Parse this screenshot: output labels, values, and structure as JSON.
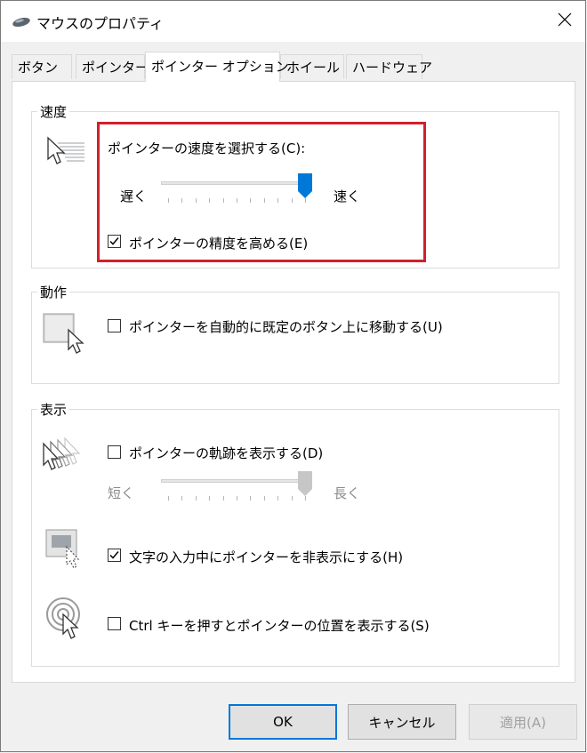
{
  "window": {
    "title": "マウスのプロパティ"
  },
  "tabs": [
    {
      "label": "ボタン",
      "active": false
    },
    {
      "label": "ポインター",
      "active": false
    },
    {
      "label": "ポインター オプション",
      "active": true
    },
    {
      "label": "ホイール",
      "active": false
    },
    {
      "label": "ハードウェア",
      "active": false
    }
  ],
  "speed": {
    "group_label": "速度",
    "select_label": "ポインターの速度を選択する(C):",
    "slow_label": "遅く",
    "fast_label": "速く",
    "slider_position": 1.0,
    "precision_label": "ポインターの精度を高める(E)",
    "precision_checked": true
  },
  "motion": {
    "group_label": "動作",
    "snap_label": "ポインターを自動的に既定のボタン上に移動する(U)",
    "snap_checked": false
  },
  "display": {
    "group_label": "表示",
    "trails_label": "ポインターの軌跡を表示する(D)",
    "trails_checked": false,
    "short_label": "短く",
    "long_label": "長く",
    "trail_slider_position": 1.0,
    "hide_label": "文字の入力中にポインターを非表示にする(H)",
    "hide_checked": true,
    "ctrl_label": "Ctrl キーを押すとポインターの位置を表示する(S)",
    "ctrl_checked": false
  },
  "buttons": {
    "ok": "OK",
    "cancel": "キャンセル",
    "apply": "適用(A)"
  },
  "colors": {
    "accent": "#0078d7",
    "highlight": "#d2202a"
  }
}
